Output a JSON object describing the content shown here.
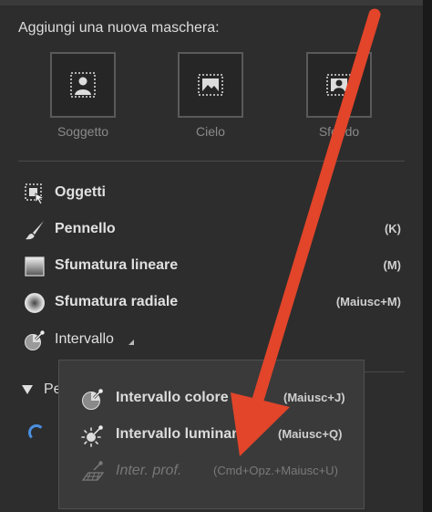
{
  "heading": "Aggiungi una nuova maschera:",
  "tiles": [
    {
      "label": "Soggetto",
      "icon": "subject-icon"
    },
    {
      "label": "Cielo",
      "icon": "sky-icon"
    },
    {
      "label": "Sfondo",
      "icon": "background-icon"
    }
  ],
  "tools": [
    {
      "label": "Oggetti",
      "shortcut": "",
      "icon": "objects-icon"
    },
    {
      "label": "Pennello",
      "shortcut": "(K)",
      "icon": "brush-icon"
    },
    {
      "label": "Sfumatura lineare",
      "shortcut": "(M)",
      "icon": "linear-gradient-icon"
    },
    {
      "label": "Sfumatura radiale",
      "shortcut": "(Maiusc+M)",
      "icon": "radial-gradient-icon"
    },
    {
      "label": "Intervallo",
      "shortcut": "",
      "icon": "range-icon"
    }
  ],
  "section": {
    "label": "Pe"
  },
  "popup": {
    "items": [
      {
        "label": "Intervallo colore",
        "shortcut": "(Maiusc+J)",
        "icon": "color-range-icon",
        "enabled": true
      },
      {
        "label": "Intervallo luminanza",
        "shortcut": "(Maiusc+Q)",
        "icon": "luminance-range-icon",
        "enabled": true
      },
      {
        "label": "Inter. prof.",
        "shortcut": "(Cmd+Opz.+Maiusc+U)",
        "icon": "depth-range-icon",
        "enabled": false
      }
    ]
  },
  "colors": {
    "annotation_arrow": "#e2452a",
    "panel_bg": "#2d2d2d",
    "accent_blue": "#4a8fe0"
  }
}
